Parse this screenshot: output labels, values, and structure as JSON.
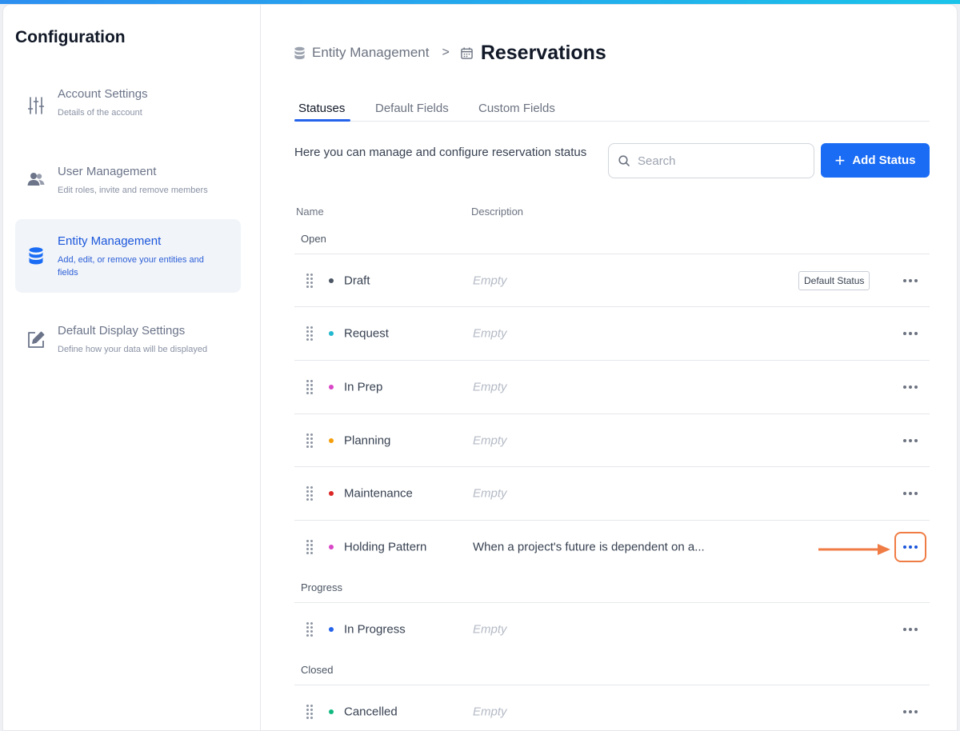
{
  "sidebar": {
    "title": "Configuration",
    "items": [
      {
        "label": "Account Settings",
        "desc": "Details of the account",
        "icon": "sliders-icon"
      },
      {
        "label": "User Management",
        "desc": "Edit roles, invite and remove members",
        "icon": "users-icon"
      },
      {
        "label": "Entity Management",
        "desc": "Add, edit, or remove your entities and fields",
        "icon": "database-icon"
      },
      {
        "label": "Default Display Settings",
        "desc": "Define how your data will be displayed",
        "icon": "edit-icon"
      }
    ]
  },
  "breadcrumb": {
    "parent": "Entity Management",
    "separator": ">",
    "current": "Reservations"
  },
  "tabs": [
    "Statuses",
    "Default Fields",
    "Custom Fields"
  ],
  "intro": "Here you can manage and configure reservation status",
  "search": {
    "placeholder": "Search"
  },
  "add_button": {
    "icon": "+",
    "label": "Add Status"
  },
  "columns": {
    "name": "Name",
    "description": "Description"
  },
  "groups": [
    {
      "label": "Open",
      "rows": [
        {
          "name": "Draft",
          "desc": "Empty",
          "color": "#4b5563",
          "badge": "Default Status"
        },
        {
          "name": "Request",
          "desc": "Empty",
          "color": "#22b8cf"
        },
        {
          "name": "In Prep",
          "desc": "Empty",
          "color": "#d946c7"
        },
        {
          "name": "Planning",
          "desc": "Empty",
          "color": "#f59e0b"
        },
        {
          "name": "Maintenance",
          "desc": "Empty",
          "color": "#dc2626"
        },
        {
          "name": "Holding Pattern",
          "desc": "When a project's future is dependent on a...",
          "color": "#d946c7"
        }
      ]
    },
    {
      "label": "Progress",
      "rows": [
        {
          "name": "In Progress",
          "desc": "Empty",
          "color": "#2563eb"
        }
      ]
    },
    {
      "label": "Closed",
      "rows": [
        {
          "name": "Cancelled",
          "desc": "Empty",
          "color": "#10b981"
        }
      ]
    }
  ],
  "colors": {
    "accent": "#1a6cf5",
    "highlight": "#f07c45"
  }
}
